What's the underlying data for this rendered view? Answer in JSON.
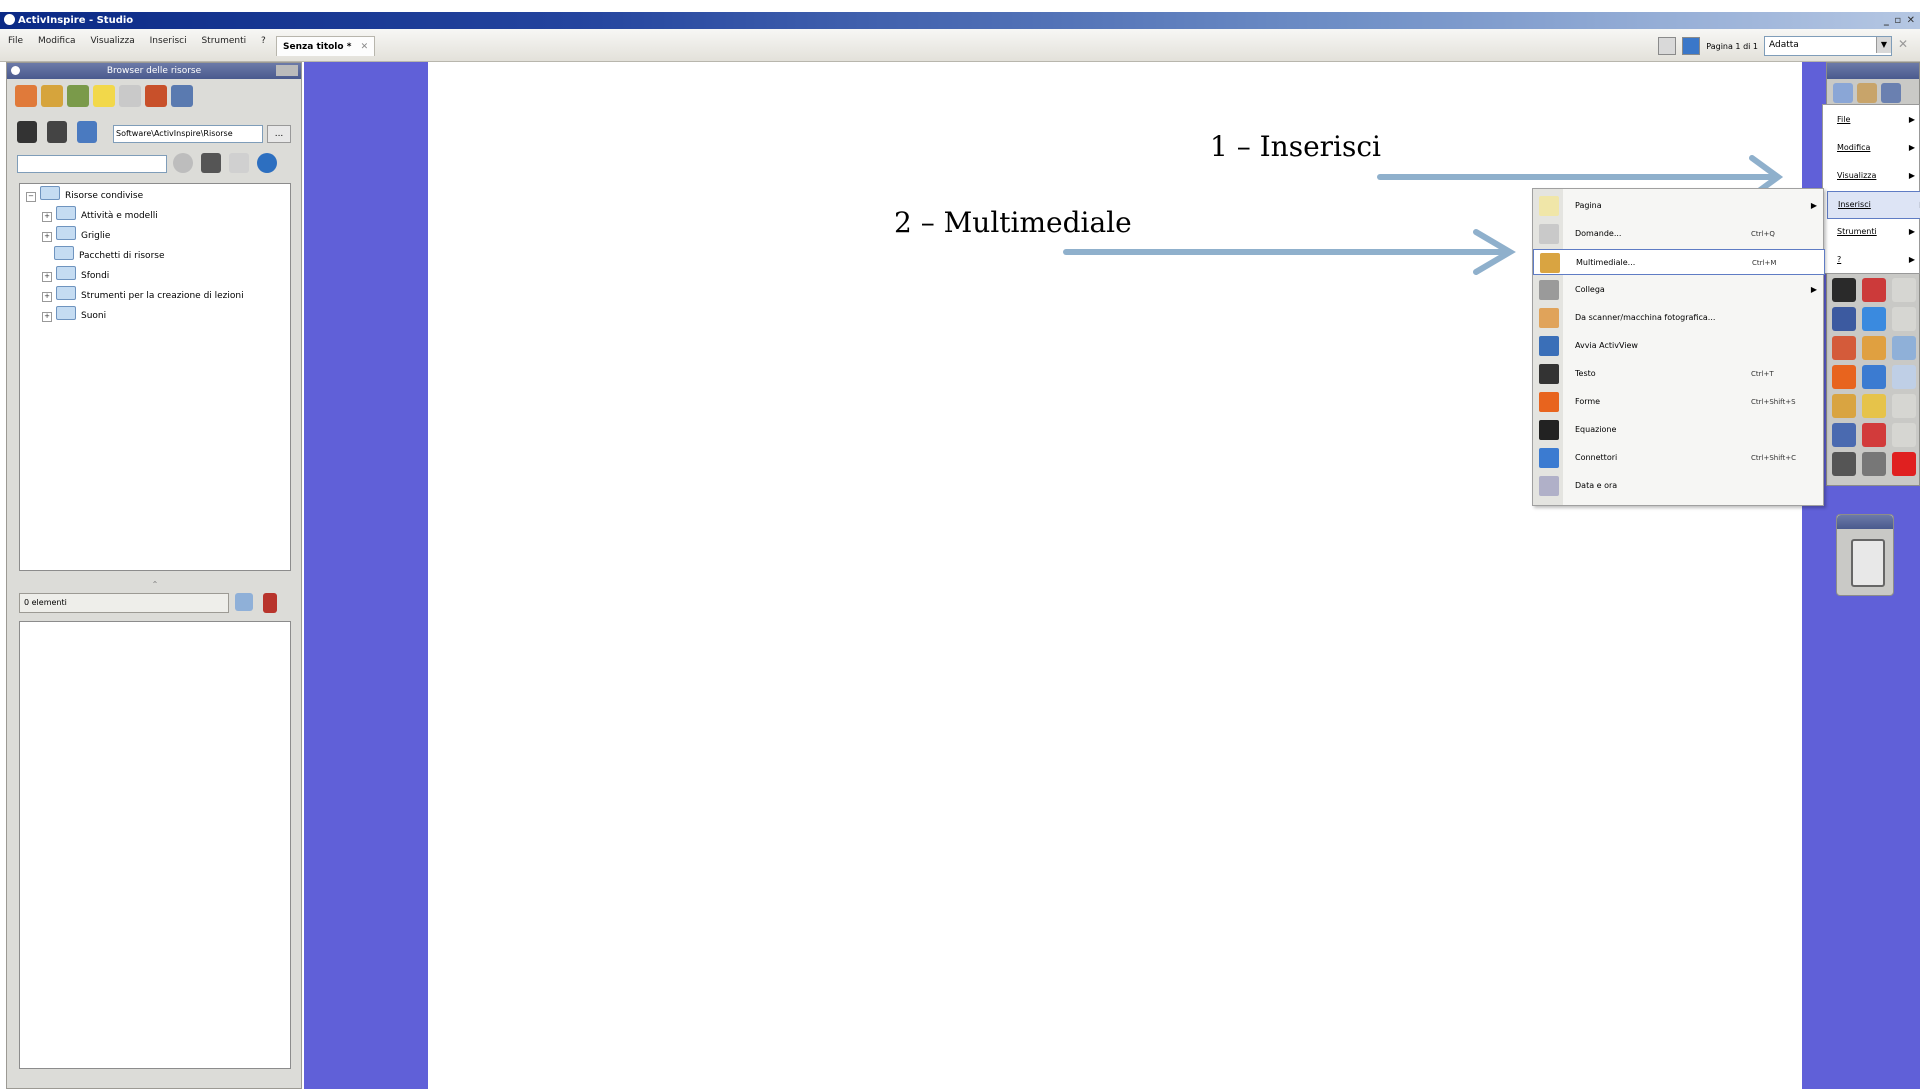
{
  "window": {
    "title": "ActivInspire - Studio",
    "controls": "_ ▫ ✕"
  },
  "menubar": {
    "items": [
      "File",
      "Modifica",
      "Visualizza",
      "Inserisci",
      "Strumenti",
      "?"
    ],
    "document_tab": "Senza titolo *",
    "page_label": "Pagina 1 di 1",
    "zoom_value": "Adatta"
  },
  "resource_browser": {
    "title": "Browser delle risorse",
    "path": "Software\\ActivInspire\\Risorse",
    "browse_button": "...",
    "tree": {
      "root": "Risorse condivise",
      "children": [
        {
          "label": "Attività e modelli",
          "expandable": true
        },
        {
          "label": "Griglie",
          "expandable": true
        },
        {
          "label": "Pacchetti di risorse",
          "expandable": false
        },
        {
          "label": "Sfondi",
          "expandable": true
        },
        {
          "label": "Strumenti per la creazione di lezioni",
          "expandable": true
        },
        {
          "label": "Suoni",
          "expandable": true
        }
      ]
    },
    "divider": "⌃",
    "count": "0 elementi"
  },
  "annotations": {
    "step1": "1 – Inserisci",
    "step2": "2 – Multimediale",
    "arrow_color": "#8fb0cc"
  },
  "main_menu": {
    "items": [
      {
        "label": "File",
        "has_submenu": true
      },
      {
        "label": "Modifica",
        "has_submenu": true
      },
      {
        "label": "Visualizza",
        "has_submenu": true
      },
      {
        "label": "Inserisci",
        "has_submenu": true,
        "selected": true
      },
      {
        "label": "Strumenti",
        "has_submenu": true
      },
      {
        "label": "?",
        "has_submenu": true
      }
    ]
  },
  "insert_menu": {
    "items": [
      {
        "label": "Pagina",
        "shortcut": "",
        "submenu": true,
        "icon": "page-icon",
        "color": "#f0e6a8"
      },
      {
        "label": "Domande...",
        "shortcut": "Ctrl+Q",
        "submenu": false,
        "icon": "questions-icon",
        "color": "#c9c9c9"
      },
      {
        "label": "Multimediale...",
        "shortcut": "Ctrl+M",
        "submenu": false,
        "icon": "multimedia-icon",
        "color": "#d9a441",
        "selected": true
      },
      {
        "label": "Collega",
        "shortcut": "",
        "submenu": true,
        "icon": "link-icon",
        "color": "#9a9a9a"
      },
      {
        "label": "Da scanner/macchina fotografica...",
        "shortcut": "",
        "submenu": false,
        "icon": "scanner-icon",
        "color": "#e0a35a"
      },
      {
        "label": "Avvia ActivView",
        "shortcut": "",
        "submenu": false,
        "icon": "activview-icon",
        "color": "#3a6fb8"
      },
      {
        "label": "Testo",
        "shortcut": "Ctrl+T",
        "submenu": false,
        "icon": "text-icon",
        "color": "#333333"
      },
      {
        "label": "Forme",
        "shortcut": "Ctrl+Shift+S",
        "submenu": false,
        "icon": "shapes-icon",
        "color": "#e8641e"
      },
      {
        "label": "Equazione",
        "shortcut": "",
        "submenu": false,
        "icon": "equation-icon",
        "color": "#222222"
      },
      {
        "label": "Connettori",
        "shortcut": "Ctrl+Shift+C",
        "submenu": false,
        "icon": "connector-icon",
        "color": "#3b7bd1"
      },
      {
        "label": "Data e ora",
        "shortcut": "",
        "submenu": false,
        "icon": "date-time-icon",
        "color": "#b0b0c8"
      }
    ]
  },
  "toolbox": {
    "rows": [
      [
        "select-arrow-icon",
        "pen-icon",
        "blank-tool-icon"
      ],
      [
        "marker-icon",
        "highlighter-icon",
        "blank-tool-icon"
      ],
      [
        "eraser-icon",
        "fill-icon",
        "resize-icon"
      ],
      [
        "shape-icon",
        "connector-tool-icon",
        "clone-icon"
      ],
      [
        "magic-ink-icon",
        "color-picker-icon",
        "blank-tool-icon"
      ],
      [
        "reset-icon",
        "clear-icon",
        "star-icon"
      ],
      [
        "undo-icon",
        "redo-icon",
        "delete-icon"
      ]
    ]
  }
}
